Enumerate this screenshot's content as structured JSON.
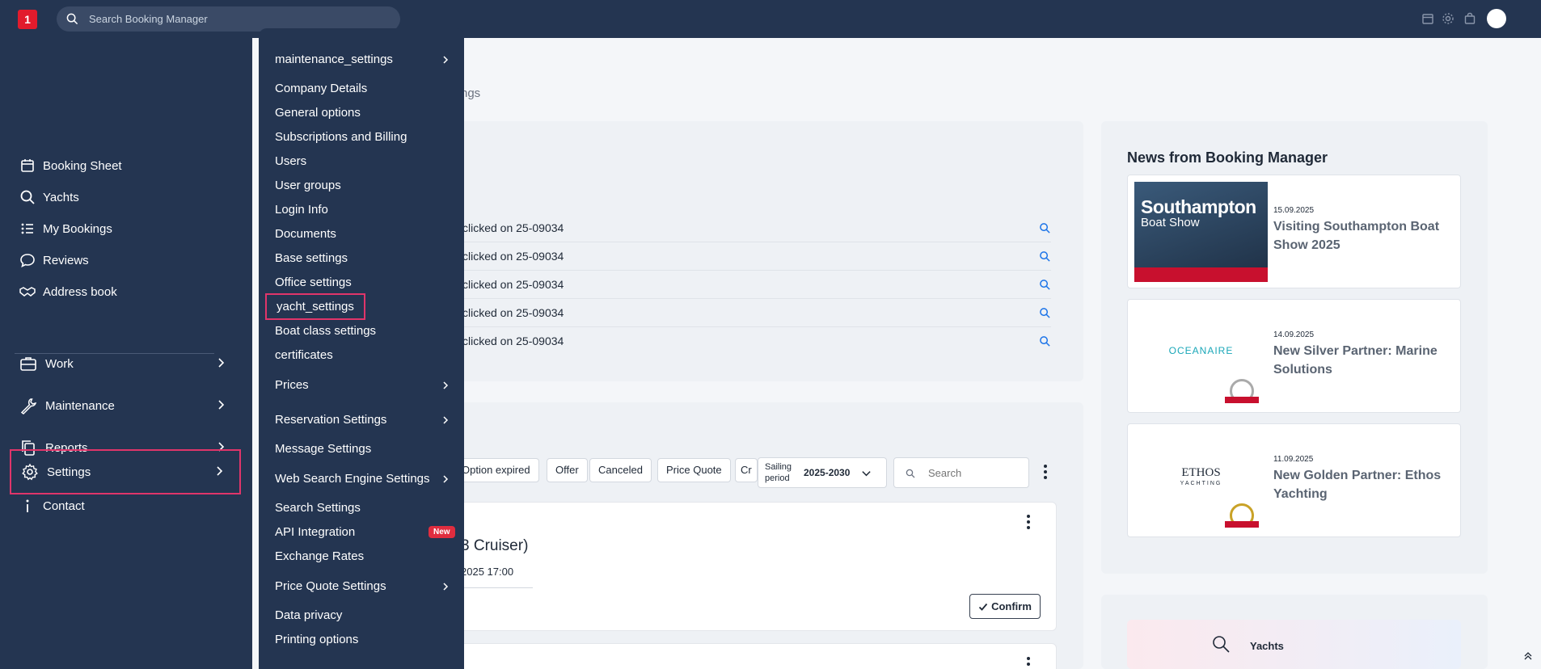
{
  "topbar": {
    "logo_text": "1",
    "search_placeholder": "Search Booking Manager",
    "icons": [
      "calendar-icon",
      "gear-icon",
      "bag-icon",
      "avatar"
    ]
  },
  "sidebar": {
    "items": [
      {
        "label": "Booking Sheet",
        "icon": "calendar-icon"
      },
      {
        "label": "Yachts",
        "icon": "search-icon"
      },
      {
        "label": "My Bookings",
        "icon": "list-icon"
      },
      {
        "label": "Reviews",
        "icon": "chat-icon"
      },
      {
        "label": "Address book",
        "icon": "handshake-icon"
      }
    ],
    "groups": [
      {
        "label": "Work",
        "icon": "briefcase-icon"
      },
      {
        "label": "Maintenance",
        "icon": "wrench-icon"
      },
      {
        "label": "Reports",
        "icon": "copy-icon"
      },
      {
        "label": "Settings",
        "icon": "gear-icon",
        "active": true
      }
    ],
    "contact_label": "Contact"
  },
  "settings_menu": {
    "items": [
      {
        "label": "maintenance_settings",
        "submenu": true
      },
      {
        "label": "Company Details"
      },
      {
        "label": "General options"
      },
      {
        "label": "Subscriptions and Billing"
      },
      {
        "label": "Users"
      },
      {
        "label": "User groups"
      },
      {
        "label": "Login Info"
      },
      {
        "label": "Documents"
      },
      {
        "label": "Base settings"
      },
      {
        "label": "Office settings"
      },
      {
        "label": "yacht_settings",
        "highlighted": true
      },
      {
        "label": "Boat class settings"
      },
      {
        "label": "certificates"
      },
      {
        "label": "Prices",
        "submenu": true
      },
      {
        "label": "Reservation Settings",
        "submenu": true
      },
      {
        "label": "Message Settings"
      },
      {
        "label": "Web Search Engine Settings",
        "submenu": true
      },
      {
        "label": "Search Settings"
      },
      {
        "label": "API Integration",
        "badge": "New"
      },
      {
        "label": "Exchange Rates"
      },
      {
        "label": "Price Quote Settings",
        "submenu": true
      },
      {
        "label": "Data privacy"
      },
      {
        "label": "Printing options"
      }
    ]
  },
  "main": {
    "breadcrumb_tail": "ngs",
    "activity_rows": [
      "clicked on 25-09034",
      "clicked on 25-09034",
      "clicked on 25-09034",
      "clicked on 25-09034",
      "clicked on 25-09034"
    ],
    "filter_chips": [
      "Option expired",
      "Offer",
      "Canceled",
      "Price Quote",
      "Cr"
    ],
    "sailing_period_label": "Sailing period",
    "sailing_period_value": "2025-2030",
    "search_placeholder": "Search",
    "reservation": {
      "title": "3 Cruiser)",
      "date": "2025 17:00",
      "confirm_label": "Confirm"
    }
  },
  "news": {
    "heading": "News from Booking Manager",
    "items": [
      {
        "date": "15.09.2025",
        "title": "Visiting Southampton Boat Show 2025",
        "image_title": "Southampton",
        "image_subtitle": "Boat Show"
      },
      {
        "date": "14.09.2025",
        "title": "New Silver Partner: Marine Solutions",
        "image_title": "OCEANAIRE"
      },
      {
        "date": "11.09.2025",
        "title": "New Golden Partner: Ethos Yachting",
        "image_title": "ETHOS",
        "image_subtitle": "YACHTING"
      }
    ]
  },
  "yachts_card": {
    "label": "Yachts"
  }
}
